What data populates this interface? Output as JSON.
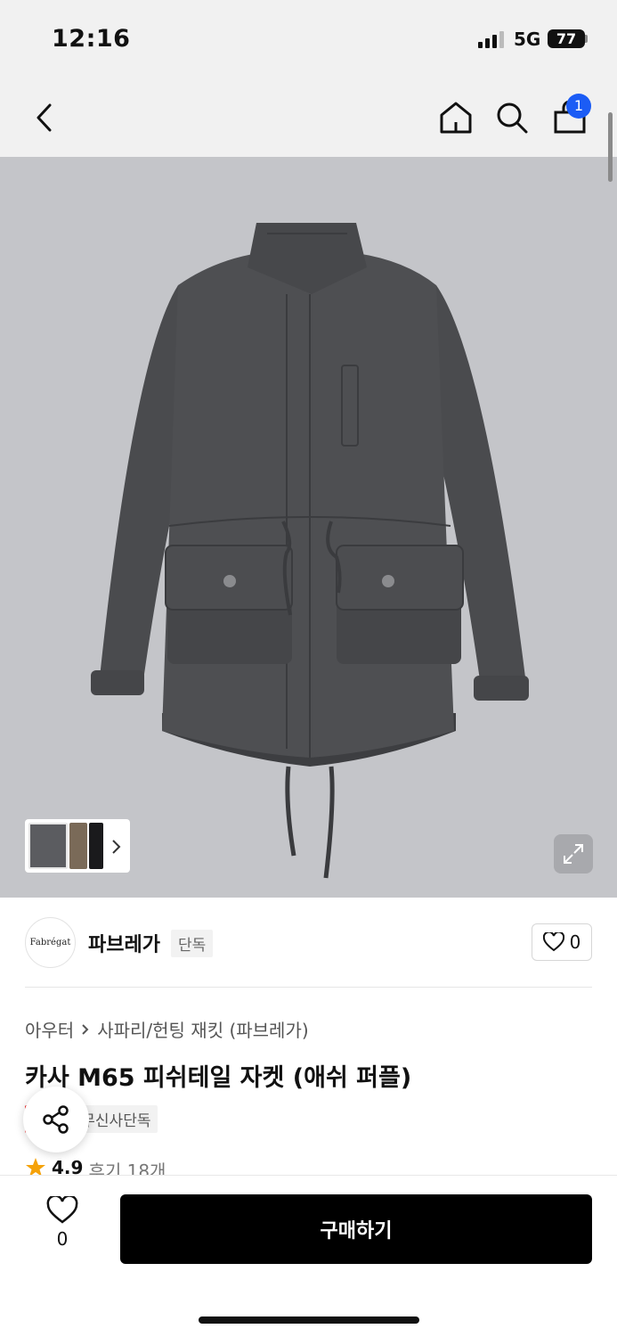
{
  "status_bar": {
    "time": "12:16",
    "network": "5G",
    "battery": "77"
  },
  "nav": {
    "back_icon": "chevron-left-icon",
    "home_icon": "home-icon",
    "search_icon": "search-icon",
    "cart_icon": "shopping-bag-icon",
    "cart_count": "1"
  },
  "colors": {
    "accent": "#1b5cf5",
    "sale": "#e81717",
    "hero_bg": "#c4c5c9",
    "jacket": "#4a4b4e"
  },
  "brand": {
    "logo_text": "Fabrégat",
    "name": "파브레가",
    "badge": "단독",
    "like_count": "0"
  },
  "product": {
    "breadcrumb": [
      "아우터",
      "사파리/헌팅 재킷 (파브레가)"
    ],
    "title": "카사 M65 피쉬테일 자켓 (애쉬 퍼플)",
    "tags": {
      "sale": "세일",
      "exclusive": "무신사단독"
    },
    "rating": "4.9",
    "reviews": "후기 18개"
  },
  "footer": {
    "wish_count": "0",
    "buy_label": "구매하기"
  }
}
